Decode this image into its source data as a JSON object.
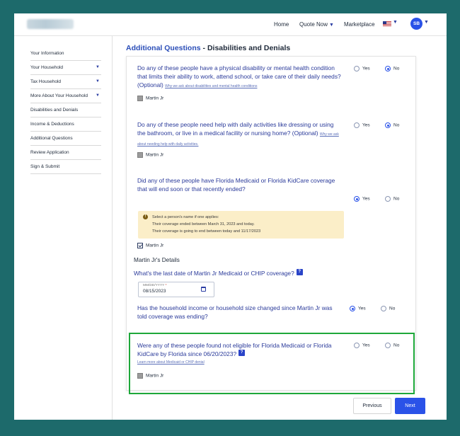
{
  "topnav": {
    "home": "Home",
    "quote_now": "Quote Now",
    "marketplace": "Marketplace",
    "avatar_initials": "SB"
  },
  "sidebar": {
    "items": [
      {
        "label": "Your Information",
        "expandable": false
      },
      {
        "label": "Your Household",
        "expandable": true
      },
      {
        "label": "Tax Household",
        "expandable": true
      },
      {
        "label": "More About Your Household",
        "expandable": true
      },
      {
        "label": "Disabilities and Denials",
        "expandable": false
      },
      {
        "label": "Income & Deductions",
        "expandable": false
      },
      {
        "label": "Additional Questions",
        "expandable": false
      },
      {
        "label": "Review Application",
        "expandable": false
      },
      {
        "label": "Sign & Submit",
        "expandable": false
      }
    ]
  },
  "page": {
    "section": "Additional Questions",
    "separator": " - ",
    "subsection": "Disabilities and Denials"
  },
  "questions": {
    "q1": {
      "text": "Do any of these people have a physical disability or mental health condition that limits their ability to work, attend school, or take care of their daily needs? (Optional)",
      "help": "Why we ask about disabilities and mental health conditions",
      "yes": "Yes",
      "no": "No",
      "selected": "No",
      "person": "Martin Jr"
    },
    "q2": {
      "text": "Do any of these people need help with daily activities like dressing or using the bathroom, or live in a medical facility or nursing home? (Optional)",
      "help": "Why we ask about needing help with daily activities.",
      "yes": "Yes",
      "no": "No",
      "selected": "No",
      "person": "Martin Jr"
    },
    "q3": {
      "text": "Did any of these people have Florida Medicaid or Florida KidCare coverage that will end soon or that recently ended?",
      "yes": "Yes",
      "no": "No",
      "selected": "Yes",
      "alert_line1": "Select a person's name if one applies:",
      "alert_line2": "Their coverage ended between March 31, 2023 and today.",
      "alert_line3": "Their coverage is going to end between today and 11/17/2023",
      "person": "Martin Jr",
      "person_checked": true
    },
    "details": {
      "title": "Martin Jr's Details",
      "date_question": "What's the last date of Martin Jr Medicaid or CHIP coverage?",
      "date_label": "MM/DD/YYYY",
      "date_required_mark": "*",
      "date_value": "08/15/2023",
      "income_question": "Has the household income or household size changed since Martin Jr was told coverage was ending?",
      "yes": "Yes",
      "no": "No",
      "selected": "Yes"
    },
    "q4": {
      "text": "Were any of these people found not eligible for Florida Medicaid or Florida KidCare by Florida since 06/20/2023?",
      "learn": "Learn more about Medicaid or CHIP denial",
      "yes": "Yes",
      "no": "No",
      "selected": "",
      "person": "Martin Jr"
    }
  },
  "footer": {
    "previous": "Previous",
    "next": "Next"
  },
  "colors": {
    "background": "#1d6a6b",
    "accent": "#2a52e8",
    "highlight": "#1ea83a",
    "alert_bg": "#fbeec8"
  }
}
